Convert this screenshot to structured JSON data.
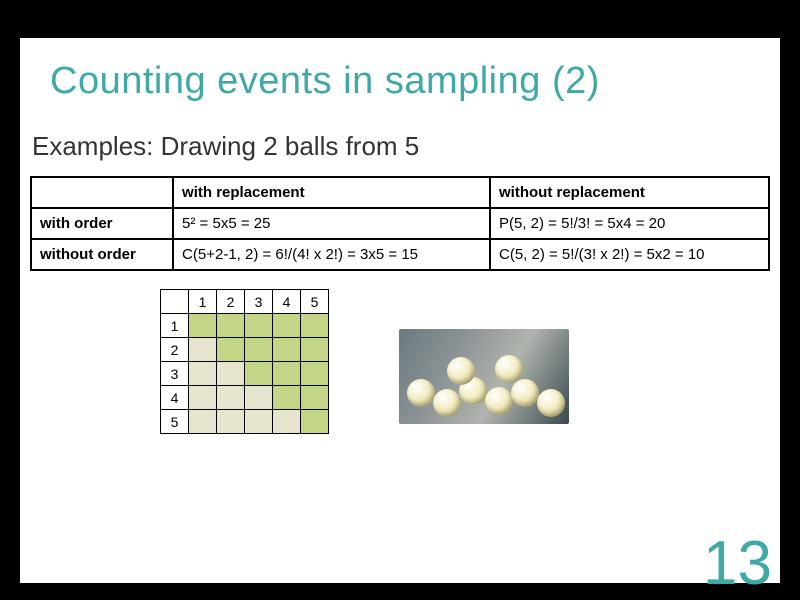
{
  "title": "Counting events in sampling (2)",
  "subtitle": "Examples: Drawing 2 balls from 5",
  "table": {
    "col1": "with replacement",
    "col2": "without replacement",
    "row1_label": "with order",
    "row1_c1": "5² = 5x5 = 25",
    "row1_c2": "P(5, 2) = 5!/3! = 5x4 = 20",
    "row2_label": "without order",
    "row2_c1": "C(5+2-1, 2) = 6!/(4! x 2!) = 3x5 = 15",
    "row2_c2": "C(5, 2) = 5!/(3! x 2!) = 5x2 = 10"
  },
  "grid": {
    "headers": [
      "1",
      "2",
      "3",
      "4",
      "5"
    ],
    "rows": [
      "1",
      "2",
      "3",
      "4",
      "5"
    ],
    "cells": [
      [
        "g",
        "g",
        "g",
        "g",
        "g"
      ],
      [
        "b",
        "g",
        "g",
        "g",
        "g"
      ],
      [
        "b",
        "b",
        "g",
        "g",
        "g"
      ],
      [
        "b",
        "b",
        "b",
        "g",
        "g"
      ],
      [
        "b",
        "b",
        "b",
        "b",
        "g"
      ]
    ]
  },
  "page_number": "13",
  "chart_data": {
    "type": "table",
    "title": "5x5 combinatorial grid (drawing 2 balls from 5)",
    "row_labels": [
      "1",
      "2",
      "3",
      "4",
      "5"
    ],
    "col_labels": [
      "1",
      "2",
      "3",
      "4",
      "5"
    ],
    "cell_category": [
      [
        "upper",
        "upper",
        "upper",
        "upper",
        "upper"
      ],
      [
        "lower",
        "upper",
        "upper",
        "upper",
        "upper"
      ],
      [
        "lower",
        "lower",
        "upper",
        "upper",
        "upper"
      ],
      [
        "lower",
        "lower",
        "lower",
        "upper",
        "upper"
      ],
      [
        "lower",
        "lower",
        "lower",
        "lower",
        "upper"
      ]
    ],
    "legend": {
      "upper": "green (diagonal + above)",
      "lower": "beige (below diagonal)"
    },
    "counts": {
      "upper": 15,
      "lower": 10,
      "total": 25
    }
  }
}
